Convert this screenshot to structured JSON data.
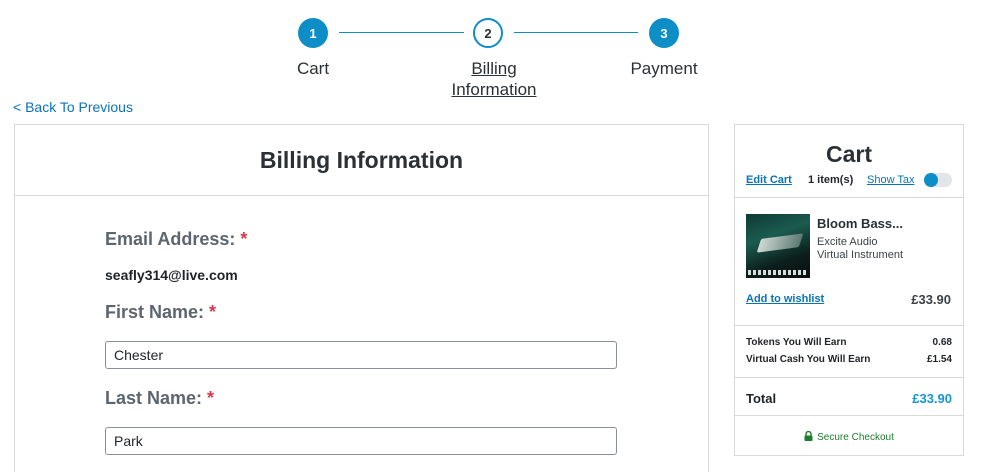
{
  "stepper": {
    "steps": [
      {
        "number": "1",
        "label": "Cart"
      },
      {
        "number": "2",
        "label_line1": "Billing",
        "label_line2": "Information"
      },
      {
        "number": "3",
        "label": "Payment"
      }
    ],
    "active_step": 2
  },
  "back_link": "< Back To Previous",
  "billing": {
    "title": "Billing Information",
    "email": {
      "label": "Email Address:",
      "required_mark": "*",
      "value": "seafly314@live.com"
    },
    "first_name": {
      "label": "First Name:",
      "required_mark": "*",
      "value": "Chester"
    },
    "last_name": {
      "label": "Last Name:",
      "required_mark": "*",
      "value": "Park"
    }
  },
  "cart": {
    "title": "Cart",
    "edit_cart": "Edit Cart",
    "item_count": "1 item(s)",
    "show_tax": "Show Tax",
    "show_tax_toggle_on": false,
    "item": {
      "name": "Bloom Bass...",
      "brand": "Excite Audio",
      "type": "Virtual Instrument",
      "wishlist": "Add to wishlist",
      "price": "£33.90"
    },
    "tokens_label": "Tokens You Will Earn",
    "tokens_value": "0.68",
    "vcash_label": "Virtual Cash You Will Earn",
    "vcash_value": "£1.54",
    "total_label": "Total",
    "total_value": "£33.90",
    "secure_checkout": "Secure Checkout"
  },
  "colors": {
    "accent": "#0d8ec7",
    "link": "#0b72b5",
    "required": "#d6394b",
    "total": "#1695d3",
    "secure": "#1e7d2e"
  }
}
